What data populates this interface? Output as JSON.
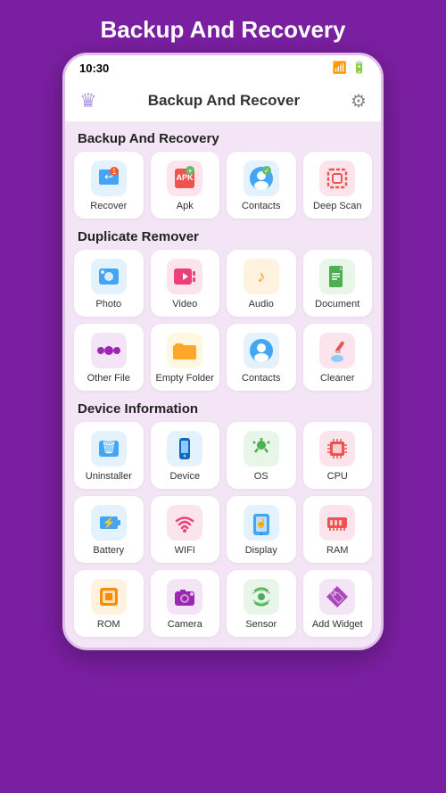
{
  "page": {
    "title": "Backup And Recovery",
    "status_bar": {
      "time": "10:30"
    },
    "header": {
      "title": "Backup And Recover"
    },
    "sections": [
      {
        "id": "backup",
        "label": "Backup And Recovery",
        "items": [
          {
            "id": "recover",
            "label": "Recover",
            "icon": "🖼️",
            "bg": "#e3f2fd",
            "color": "#1e88e5"
          },
          {
            "id": "apk",
            "label": "Apk",
            "icon": "📦",
            "bg": "#fce4ec",
            "color": "#e53935"
          },
          {
            "id": "contacts-backup",
            "label": "Contacts",
            "icon": "👤",
            "bg": "#e3f2fd",
            "color": "#1e88e5"
          },
          {
            "id": "deep-scan",
            "label": "Deep Scan",
            "icon": "⬛",
            "bg": "#fce4ec",
            "color": "#e53935"
          }
        ]
      },
      {
        "id": "duplicate",
        "label": "Duplicate Remover",
        "items": [
          {
            "id": "photo",
            "label": "Photo",
            "icon": "🖼️",
            "bg": "#e3f2fd",
            "color": "#1e88e5"
          },
          {
            "id": "video",
            "label": "Video",
            "icon": "▶️",
            "bg": "#fce4ec",
            "color": "#e91e63"
          },
          {
            "id": "audio",
            "label": "Audio",
            "icon": "🎵",
            "bg": "#fff3e0",
            "color": "#fb8c00"
          },
          {
            "id": "document",
            "label": "Document",
            "icon": "📄",
            "bg": "#e8f5e9",
            "color": "#43a047"
          },
          {
            "id": "other-file",
            "label": "Other File",
            "icon": "⚙️",
            "bg": "#f3e5f5",
            "color": "#8e24aa"
          },
          {
            "id": "empty-folder",
            "label": "Empty Folder",
            "icon": "📁",
            "bg": "#fff8e1",
            "color": "#ffa000"
          },
          {
            "id": "contacts-dup",
            "label": "Contacts",
            "icon": "👤",
            "bg": "#e3f2fd",
            "color": "#1e88e5"
          },
          {
            "id": "cleaner",
            "label": "Cleaner",
            "icon": "🧹",
            "bg": "#fce4ec",
            "color": "#e53935"
          }
        ]
      },
      {
        "id": "device",
        "label": "Device Information",
        "items": [
          {
            "id": "uninstaller",
            "label": "Uninstaller",
            "icon": "🗑️",
            "bg": "#e3f2fd",
            "color": "#1e88e5"
          },
          {
            "id": "device",
            "label": "Device",
            "icon": "📱",
            "bg": "#e3f2fd",
            "color": "#1565c0"
          },
          {
            "id": "os",
            "label": "OS",
            "icon": "🤖",
            "bg": "#e8f5e9",
            "color": "#43a047"
          },
          {
            "id": "cpu",
            "label": "CPU",
            "icon": "🔲",
            "bg": "#fce4ec",
            "color": "#e53935"
          },
          {
            "id": "battery",
            "label": "Battery",
            "icon": "🔋",
            "bg": "#e3f2fd",
            "color": "#1e88e5"
          },
          {
            "id": "wifi",
            "label": "WIFI",
            "icon": "📶",
            "bg": "#fce4ec",
            "color": "#e91e63"
          },
          {
            "id": "display",
            "label": "Display",
            "icon": "📱",
            "bg": "#e3f2fd",
            "color": "#1e88e5"
          },
          {
            "id": "ram",
            "label": "RAM",
            "icon": "🔲",
            "bg": "#fce4ec",
            "color": "#e53935"
          },
          {
            "id": "rom",
            "label": "ROM",
            "icon": "🔲",
            "bg": "#fff3e0",
            "color": "#fb8c00"
          },
          {
            "id": "camera",
            "label": "Camera",
            "icon": "📷",
            "bg": "#f3e5f5",
            "color": "#8e24aa"
          },
          {
            "id": "sensor",
            "label": "Sensor",
            "icon": "📡",
            "bg": "#e8f5e9",
            "color": "#43a047"
          },
          {
            "id": "add-widget",
            "label": "Add Widget",
            "icon": "🏷️",
            "bg": "#f3e5f5",
            "color": "#7b1fa2"
          }
        ]
      }
    ]
  }
}
